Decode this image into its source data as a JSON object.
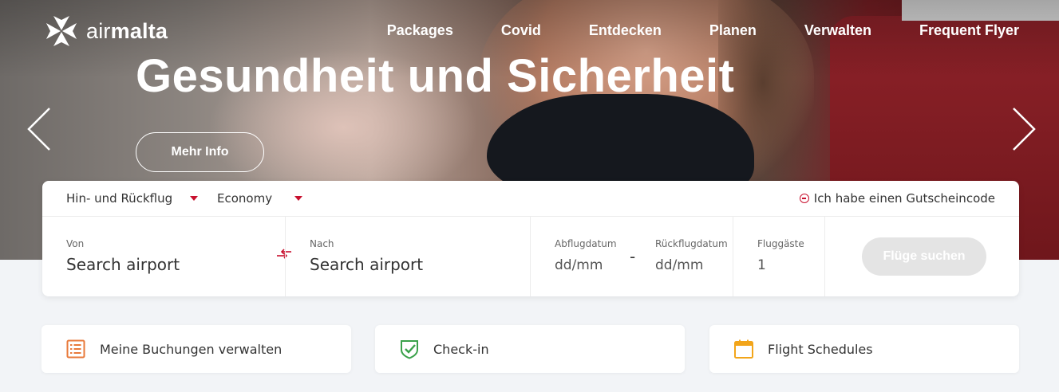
{
  "brand": {
    "name_light": "air",
    "name_bold": "malta"
  },
  "nav": {
    "items": [
      "Packages",
      "Covid",
      "Entdecken",
      "Planen",
      "Verwalten",
      "Frequent Flyer"
    ]
  },
  "hero": {
    "title": "Gesundheit und Sicherheit",
    "cta_label": "Mehr Info"
  },
  "search": {
    "trip_type": "Hin- und Rückflug",
    "cabin_class": "Economy",
    "voucher_label": "Ich habe einen Gutscheincode",
    "from": {
      "label": "Von",
      "placeholder": "Search airport"
    },
    "to": {
      "label": "Nach",
      "placeholder": "Search airport"
    },
    "departure": {
      "label": "Abflugdatum",
      "placeholder": "dd/mm"
    },
    "return": {
      "label": "Rückflugdatum",
      "placeholder": "dd/mm"
    },
    "date_separator": "-",
    "passengers": {
      "label": "Fluggäste",
      "value": "1"
    },
    "submit_label": "Flüge suchen"
  },
  "quick_links": [
    {
      "label": "Meine Buchungen verwalten",
      "icon": "list-icon"
    },
    {
      "label": "Check-in",
      "icon": "shield-check-icon"
    },
    {
      "label": "Flight Schedules",
      "icon": "calendar-icon"
    }
  ],
  "colors": {
    "accent": "#c8102e",
    "list_icon": "#e8793a",
    "check_icon": "#3aa14a",
    "calendar_icon": "#f2a51a",
    "disabled_button": "#e4e4e4"
  }
}
